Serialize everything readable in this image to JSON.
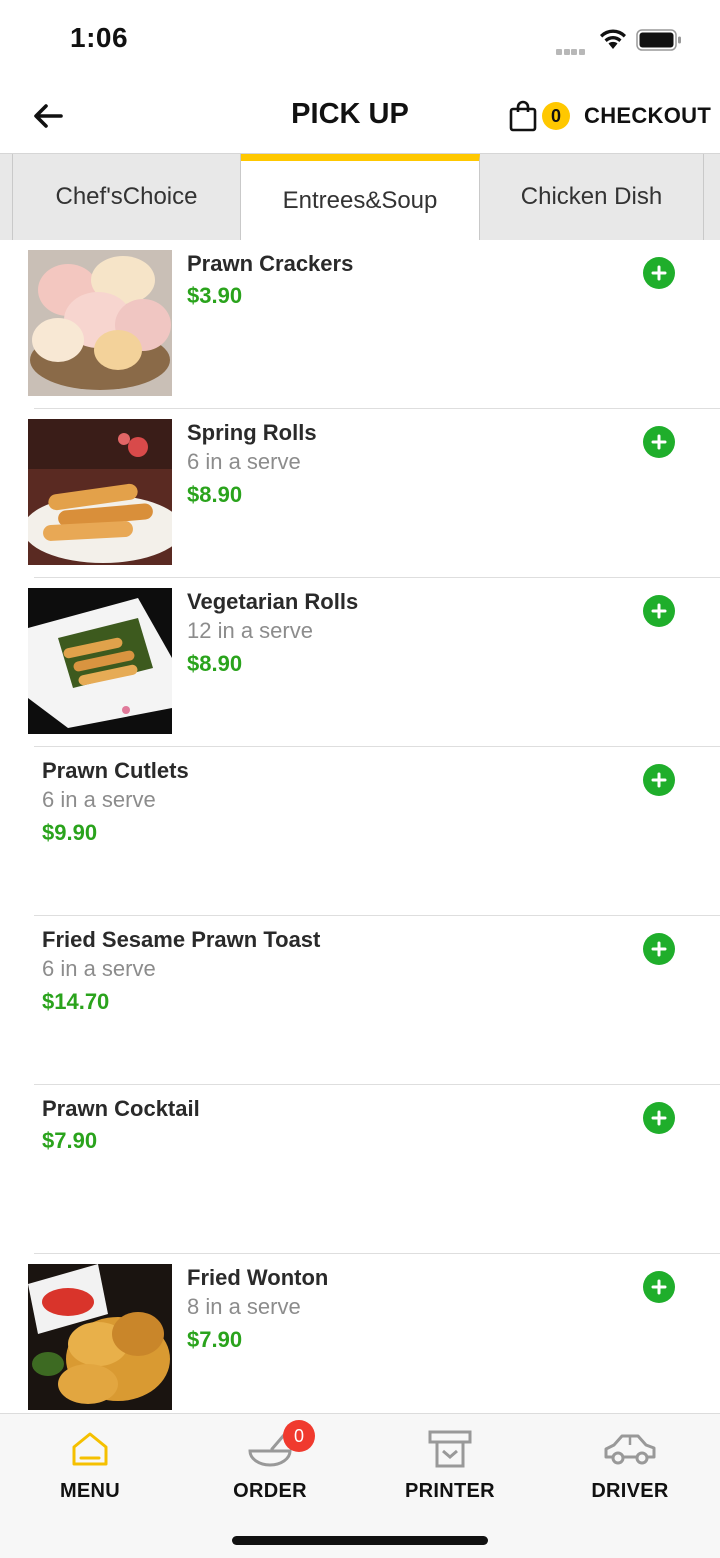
{
  "status_bar": {
    "time": "1:06"
  },
  "header": {
    "title": "PICK UP",
    "cart_count": "0",
    "checkout_label": "CHECKOUT"
  },
  "tabs": [
    {
      "label": "Chef'sChoice"
    },
    {
      "label": "Entrees&Soup",
      "active": true
    },
    {
      "label": "Chicken Dish"
    }
  ],
  "menu_items": [
    {
      "name": "Prawn Crackers",
      "desc": "",
      "price": "$3.90",
      "image": "prawn-crackers-photo"
    },
    {
      "name": "Spring Rolls",
      "desc": "6 in a serve",
      "price": "$8.90",
      "image": "spring-rolls-photo"
    },
    {
      "name": "Vegetarian Rolls",
      "desc": "12 in a serve",
      "price": "$8.90",
      "image": "vegetarian-rolls-photo"
    },
    {
      "name": "Prawn Cutlets",
      "desc": "6 in a serve",
      "price": "$9.90",
      "image": ""
    },
    {
      "name": "Fried Sesame Prawn Toast",
      "desc": "6 in a serve",
      "price": "$14.70",
      "image": ""
    },
    {
      "name": "Prawn Cocktail",
      "desc": "",
      "price": "$7.90",
      "image": ""
    },
    {
      "name": "Fried Wonton",
      "desc": "8 in a serve",
      "price": "$7.90",
      "image": "fried-wonton-photo"
    }
  ],
  "tabbar": {
    "items": [
      {
        "label": "MENU",
        "icon": "home-icon",
        "active": true
      },
      {
        "label": "ORDER",
        "icon": "bowl-icon",
        "badge": "0"
      },
      {
        "label": "PRINTER",
        "icon": "printer-icon"
      },
      {
        "label": "DRIVER",
        "icon": "car-icon"
      }
    ]
  },
  "colors": {
    "accent": "#ffc800",
    "price": "#2aa31c",
    "add_button": "#1fae2b",
    "badge": "#f03a2e"
  }
}
